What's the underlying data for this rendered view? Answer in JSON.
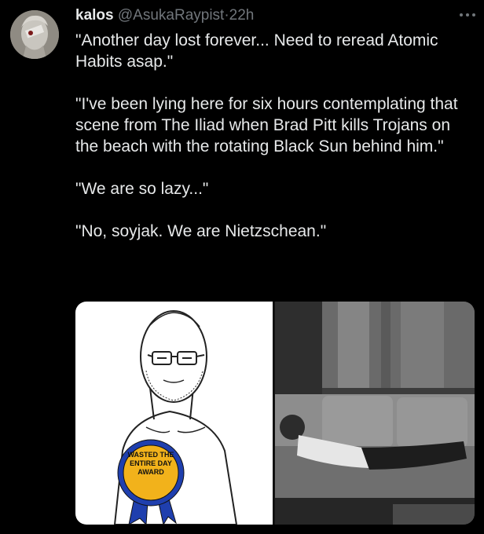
{
  "post": {
    "display_name": "kalos",
    "handle": "@AsukaRaypist",
    "separator": "·",
    "time": "22h",
    "more_icon": "more-icon",
    "paragraphs": [
      "\"Another day lost forever... Need to reread Atomic Habits asap.\"",
      "\"I've been lying here for six hours contemplating that scene from The Iliad when Brad Pitt kills Trojans on the beach with the rotating Black Sun behind him.\"",
      "\"We are so lazy...\"",
      "\"No, soyjak. We are Nietzschean.\""
    ]
  },
  "media": {
    "badge_text": "WASTED THE ENTIRE DAY AWARD"
  }
}
